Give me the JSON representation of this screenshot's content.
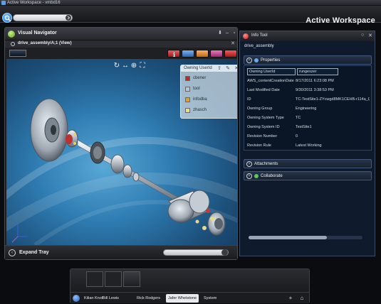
{
  "window": {
    "title": "Active Workspace - vmbd16"
  },
  "header": {
    "workspace_title": "Active Workspace"
  },
  "visual_navigator": {
    "title": "Visual Navigator",
    "object_path": "drive_assembly/A;1 (View)",
    "legend": {
      "title": "Owning UserId",
      "items": [
        {
          "label": "cbener",
          "color": "#b03030"
        },
        {
          "label": "tool",
          "color": "#a9c8e8"
        },
        {
          "label": "infodba",
          "color": "#e0a030"
        },
        {
          "label": "zhasch",
          "color": "#e6e08a"
        }
      ]
    },
    "expand_tray_label": "Expand Tray"
  },
  "info_tool": {
    "title": "Info Tool",
    "object_name": "drive_assembly",
    "sections": {
      "properties": "Properties",
      "attachments": "Attachments",
      "collaborate": "Collaborate"
    },
    "properties": [
      {
        "key": "Owning UserId",
        "value": "rungeszer"
      },
      {
        "key": "AWS_contentCreationDate",
        "value": "8/17/2011 6:23:08 PM"
      },
      {
        "key": "Last Modified Date",
        "value": "9/30/2011 3:38:53 PM"
      },
      {
        "key": "ID",
        "value": "TC-TestSite1-ZYcwgd8MK1CEHB-r114a_QmMu"
      },
      {
        "key": "Owning Group",
        "value": "Engineering"
      },
      {
        "key": "Owning System Type",
        "value": "TC"
      },
      {
        "key": "Owning System ID",
        "value": "TestSite1"
      },
      {
        "key": "Revision Number",
        "value": "0"
      },
      {
        "key": "Revision Rule",
        "value": "Latest Working"
      }
    ]
  },
  "tray": {
    "tabs": [
      "Kilian Knoll",
      "Bill Lewis",
      "Rick Rodgers",
      "Jafer Whetstone",
      "System"
    ],
    "active_tab": "Jafer Whetstone"
  },
  "colors": {
    "accent": "#2f7db3",
    "toolbar_info": "#c62d2d",
    "toolbar_tab2": "#3f7fc8",
    "toolbar_tab3": "#e27f22",
    "toolbar_tab4": "#c43b8e",
    "toolbar_tab5": "#c42626"
  }
}
